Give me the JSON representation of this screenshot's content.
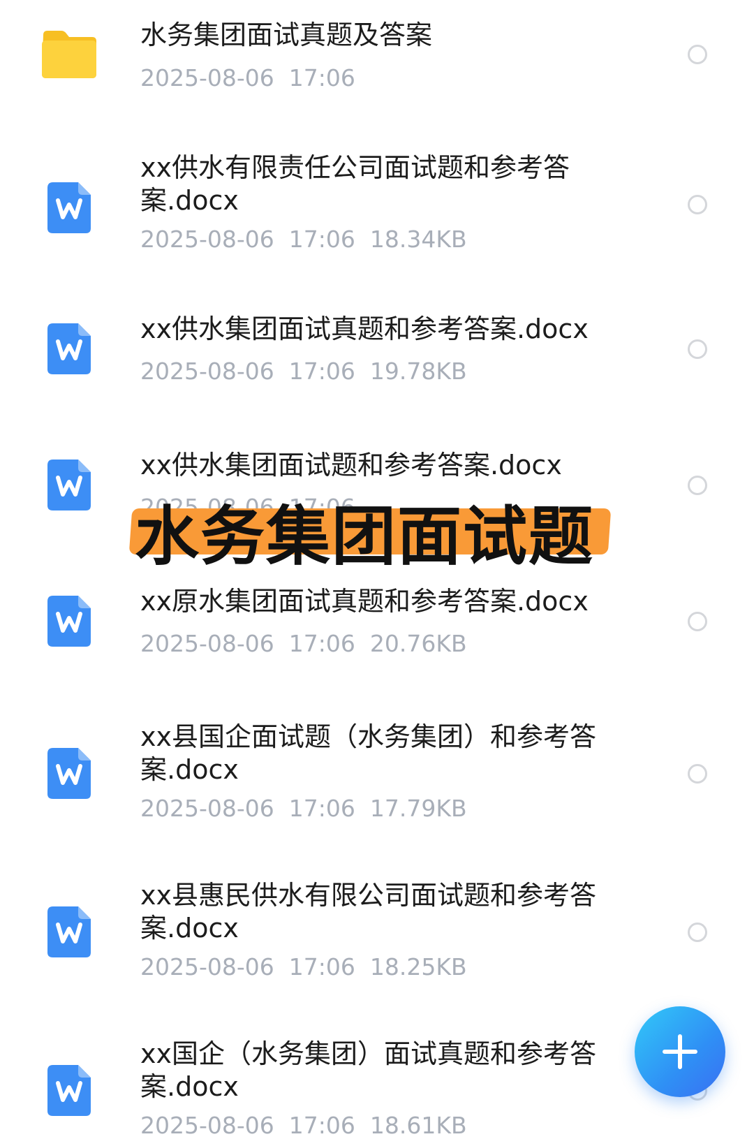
{
  "files": [
    {
      "type": "folder",
      "name": "水务集团面试真题及答案",
      "date": "2025-08-06",
      "time": "17:06",
      "size": ""
    },
    {
      "type": "docx",
      "name": "xx供水有限责任公司面试题和参考答案.docx",
      "date": "2025-08-06",
      "time": "17:06",
      "size": "18.34KB"
    },
    {
      "type": "docx",
      "name": "xx供水集团面试真题和参考答案.docx",
      "date": "2025-08-06",
      "time": "17:06",
      "size": "19.78KB"
    },
    {
      "type": "docx",
      "name": "xx供水集团面试题和参考答案.docx",
      "date": "2025-08-06",
      "time": "17:06",
      "size": ""
    },
    {
      "type": "docx",
      "name": "xx原水集团面试真题和参考答案.docx",
      "date": "2025-08-06",
      "time": "17:06",
      "size": "20.76KB"
    },
    {
      "type": "docx",
      "name": "xx县国企面试题（水务集团）和参考答案.docx",
      "date": "2025-08-06",
      "time": "17:06",
      "size": "17.79KB"
    },
    {
      "type": "docx",
      "name": "xx县惠民供水有限公司面试题和参考答案.docx",
      "date": "2025-08-06",
      "time": "17:06",
      "size": "18.25KB"
    },
    {
      "type": "docx",
      "name": "xx国企（水务集团）面试真题和参考答案.docx",
      "date": "2025-08-06",
      "time": "17:06",
      "size": "18.61KB"
    }
  ],
  "overlay": {
    "text": "水务集团面试题"
  },
  "fab": {
    "icon": "plus-icon"
  },
  "colors": {
    "accent": "#2f8ff5",
    "word_icon": "#3d8ef5",
    "folder": "#fcc933",
    "highlight": "#f99a37"
  }
}
